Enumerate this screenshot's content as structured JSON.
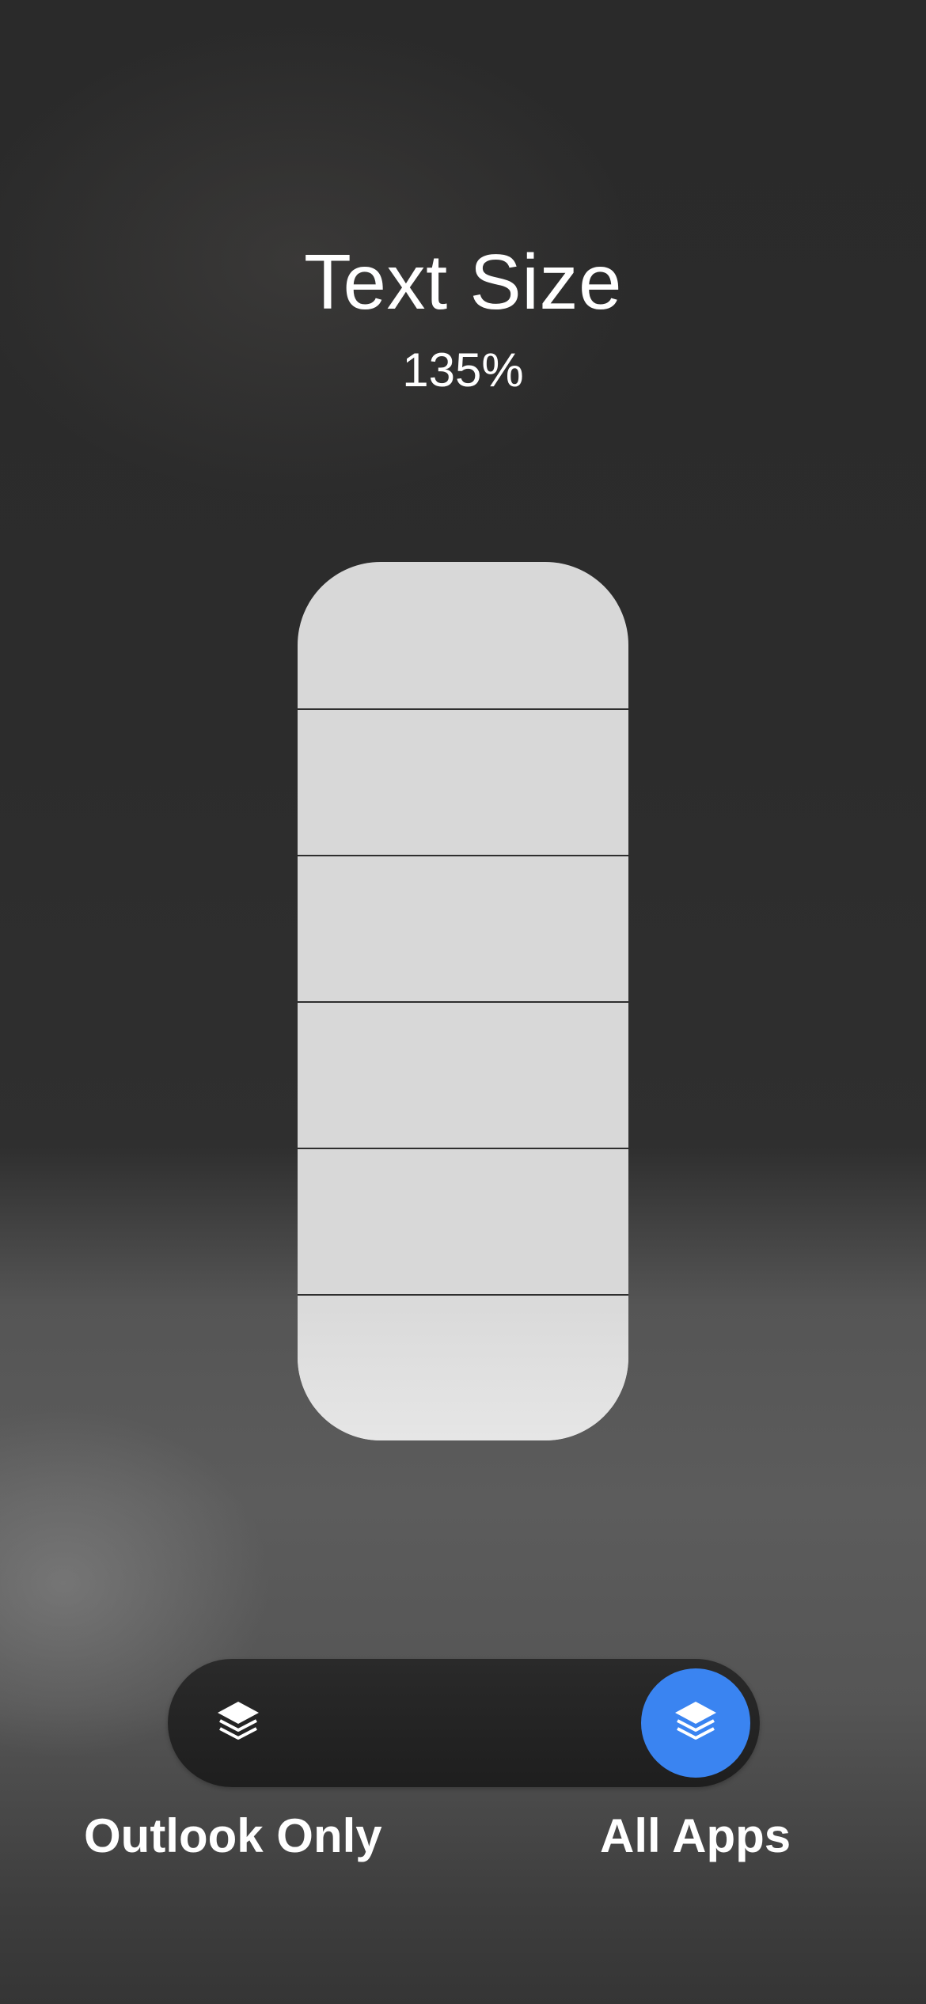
{
  "header": {
    "title": "Text Size",
    "value": "135%"
  },
  "slider": {
    "steps": 6,
    "filled_steps": 1,
    "level_fraction": 0.1667
  },
  "scope_toggle": {
    "left_label": "Outlook Only",
    "right_label": "All Apps",
    "selected": "All Apps",
    "left_icon": "layers-icon",
    "right_icon": "layers-icon"
  },
  "colors": {
    "accent": "#3a84f1",
    "slider_track": "#d8d8d8",
    "toggle_background": "#262626"
  }
}
